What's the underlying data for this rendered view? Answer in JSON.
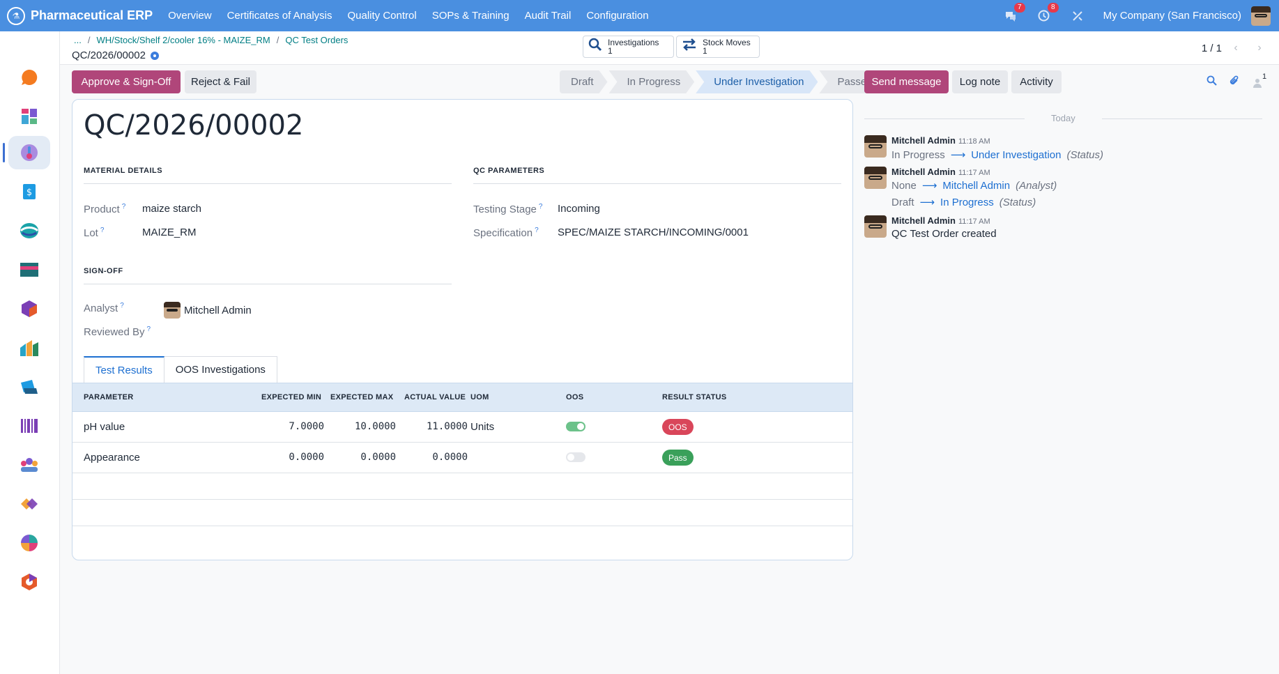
{
  "navbar": {
    "brand": "Pharmaceutical ERP",
    "menu": [
      "Overview",
      "Certificates of Analysis",
      "Quality Control",
      "SOPs & Training",
      "Audit Trail",
      "Configuration"
    ],
    "messages_count": "7",
    "activities_count": "8",
    "company": "My Company (San Francisco)"
  },
  "sidebar": {
    "apps": [
      "discuss",
      "dashboards",
      "quality-control",
      "invoicing",
      "crm",
      "sales",
      "inventory",
      "purchase",
      "documents",
      "barcode",
      "employees",
      "project",
      "reporting",
      "settings"
    ]
  },
  "breadcrumb": {
    "ellipsis": "...",
    "items": [
      "WH/Stock/Shelf 2/cooler 16% - MAIZE_RM",
      "QC Test Orders"
    ],
    "separator": "/",
    "current": "QC/2026/00002"
  },
  "smart_buttons": [
    {
      "label": "Investigations",
      "count": "1"
    },
    {
      "label": "Stock Moves",
      "count": "1"
    }
  ],
  "pager": {
    "value": "1 / 1"
  },
  "actions": {
    "approve": "Approve & Sign-Off",
    "reject": "Reject & Fail"
  },
  "statusbar": {
    "stages": [
      "Draft",
      "In Progress",
      "Under Investigation",
      "Passed"
    ],
    "active": "Under Investigation"
  },
  "form": {
    "title": "QC/2026/00002",
    "material_section": "MATERIAL DETAILS",
    "qc_section": "QC PARAMETERS",
    "signoff_section": "SIGN-OFF",
    "product_label": "Product",
    "product": "maize starch",
    "lot_label": "Lot",
    "lot": "MAIZE_RM",
    "stage_label": "Testing Stage",
    "stage": "Incoming",
    "spec_label": "Specification",
    "spec": "SPEC/MAIZE STARCH/INCOMING/0001",
    "analyst_label": "Analyst",
    "analyst": "Mitchell Admin",
    "reviewed_label": "Reviewed By",
    "help_mark": "?"
  },
  "tabs": [
    "Test Results",
    "OOS Investigations"
  ],
  "table": {
    "headers": [
      "PARAMETER",
      "EXPECTED MIN",
      "EXPECTED MAX",
      "ACTUAL VALUE",
      "UOM",
      "OOS",
      "RESULT STATUS"
    ],
    "rows": [
      {
        "parameter": "pH value",
        "min": "7.0000",
        "max": "10.0000",
        "actual": "11.0000",
        "uom": "Units",
        "oos": true,
        "status": "OOS"
      },
      {
        "parameter": "Appearance",
        "min": "0.0000",
        "max": "0.0000",
        "actual": "0.0000",
        "uom": "",
        "oos": false,
        "status": "Pass"
      }
    ]
  },
  "chatter": {
    "send": "Send message",
    "log": "Log note",
    "activity": "Activity",
    "followers": "1",
    "today": "Today",
    "messages": [
      {
        "author": "Mitchell Admin",
        "time": "11:18 AM",
        "changes": [
          {
            "old": "In Progress",
            "new": "Under Investigation",
            "field": "(Status)"
          }
        ]
      },
      {
        "author": "Mitchell Admin",
        "time": "11:17 AM",
        "changes": [
          {
            "old": "None",
            "new": "Mitchell Admin",
            "field": "(Analyst)"
          },
          {
            "old": "Draft",
            "new": "In Progress",
            "field": "(Status)"
          }
        ]
      },
      {
        "author": "Mitchell Admin",
        "time": "11:17 AM",
        "body": "QC Test Order created"
      }
    ]
  },
  "colors": {
    "navbar": "#4a8fe0",
    "primary": "#b0467a",
    "oos_badge": "#d9465a",
    "pass_badge": "#3aa05a",
    "toggle_on": "#6cc28a"
  }
}
